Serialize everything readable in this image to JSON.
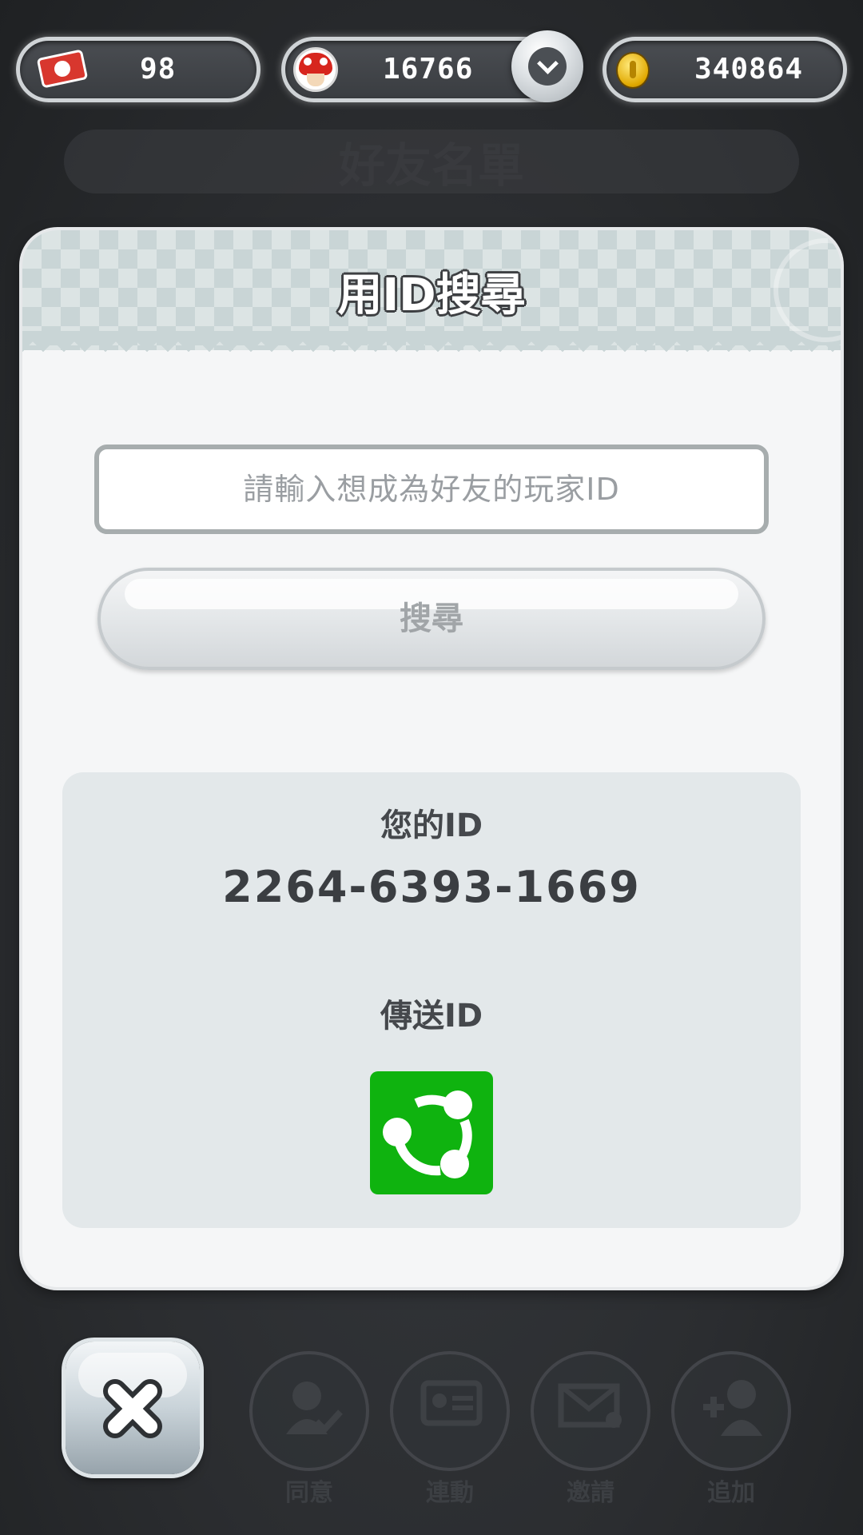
{
  "status_bar": {
    "tickets": "98",
    "toad_count": "16766",
    "coins": "340864"
  },
  "background_screen": {
    "title": "好友名單",
    "nav": {
      "agree": "同意",
      "link": "連動",
      "invite": "邀請",
      "add": "追加"
    }
  },
  "modal": {
    "title": "用ID搜尋",
    "input_placeholder": "請輸入想成為好友的玩家ID",
    "search_label": "搜尋",
    "your_id_label": "您的ID",
    "your_id_value": "2264-6393-1669",
    "send_id_label": "傳送ID"
  },
  "colors": {
    "share_green": "#0fb30f",
    "panel": "#e3e8ea",
    "header": "#c9d5d6"
  },
  "icons": [
    "ticket-icon",
    "toad-icon",
    "coin-icon",
    "chevron-down-icon",
    "share-icon",
    "close-icon",
    "person-check-icon",
    "id-card-link-icon",
    "envelope-person-icon",
    "add-person-icon"
  ]
}
